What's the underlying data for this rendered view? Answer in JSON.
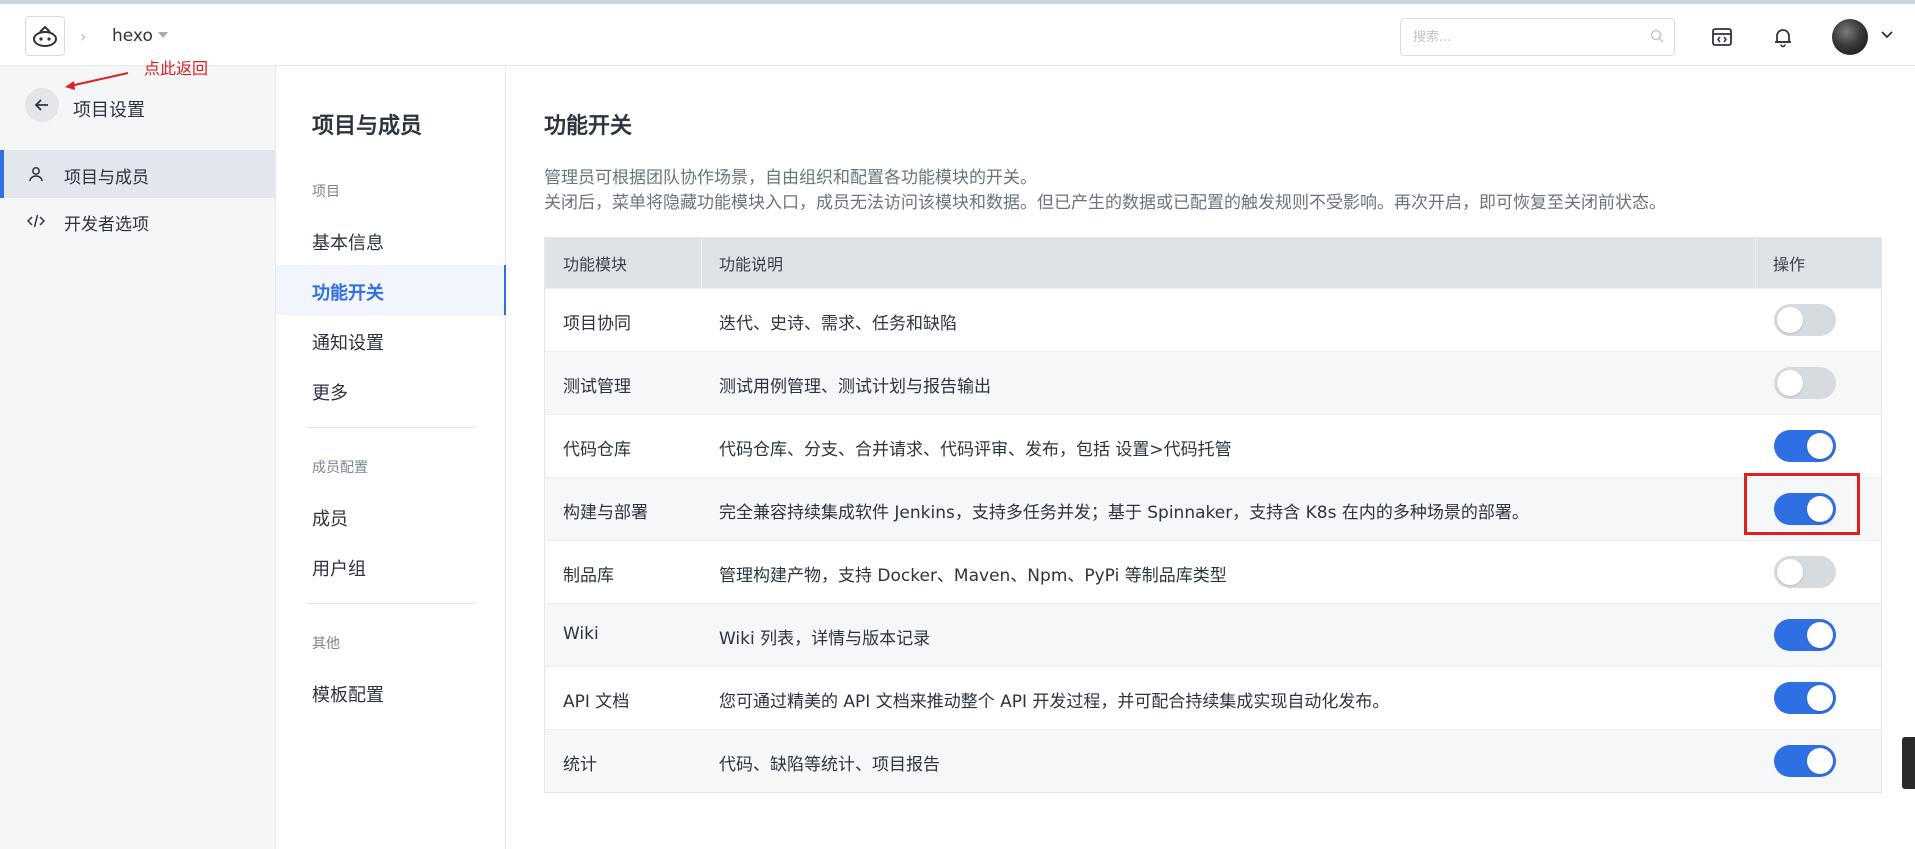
{
  "header": {
    "project_name": "hexo",
    "search_placeholder": "搜索..."
  },
  "annotation": {
    "text": "点此返回",
    "color": "#e02020"
  },
  "sidebar": {
    "title": "项目设置",
    "items": [
      {
        "label": "项目与成员",
        "icon": "user-icon",
        "active": true
      },
      {
        "label": "开发者选项",
        "icon": "code-icon",
        "active": false
      }
    ]
  },
  "subnav": {
    "title": "项目与成员",
    "groups": [
      {
        "label": "项目",
        "items": [
          "基本信息",
          "功能开关",
          "通知设置",
          "更多"
        ]
      },
      {
        "label": "成员配置",
        "items": [
          "成员",
          "用户组"
        ]
      },
      {
        "label": "其他",
        "items": [
          "模板配置"
        ]
      }
    ],
    "active_item": "功能开关"
  },
  "main": {
    "title": "功能开关",
    "desc_line1": "管理员可根据团队协作场景，自由组织和配置各功能模块的开关。",
    "desc_line2": "关闭后，菜单将隐藏功能模块入口，成员无法访问该模块和数据。但已产生的数据或已配置的触发规则不受影响。再次开启，即可恢复至关闭前状态。",
    "table": {
      "headers": [
        "功能模块",
        "功能说明",
        "操作"
      ],
      "rows": [
        {
          "name": "项目协同",
          "desc": "迭代、史诗、需求、任务和缺陷",
          "enabled": false
        },
        {
          "name": "测试管理",
          "desc": "测试用例管理、测试计划与报告输出",
          "enabled": false
        },
        {
          "name": "代码仓库",
          "desc": "代码仓库、分支、合并请求、代码评审、发布，包括 设置>代码托管",
          "enabled": true
        },
        {
          "name": "构建与部署",
          "desc": "完全兼容持续集成软件 Jenkins，支持多任务并发；基于 Spinnaker，支持含 K8s 在内的多种场景的部署。",
          "enabled": true
        },
        {
          "name": "制品库",
          "desc": "管理构建产物，支持 Docker、Maven、Npm、PyPi 等制品库类型",
          "enabled": false
        },
        {
          "name": "Wiki",
          "desc": "Wiki 列表，详情与版本记录",
          "enabled": true
        },
        {
          "name": "API 文档",
          "desc": "您可通过精美的 API 文档来推动整个 API 开发过程，并可配合持续集成实现自动化发布。",
          "enabled": true
        },
        {
          "name": "统计",
          "desc": "代码、缺陷等统计、项目报告",
          "enabled": true
        }
      ]
    }
  },
  "colors": {
    "accent": "#2f6fe4",
    "toggle_off": "#d7dade",
    "annotation_red": "#e02020"
  }
}
